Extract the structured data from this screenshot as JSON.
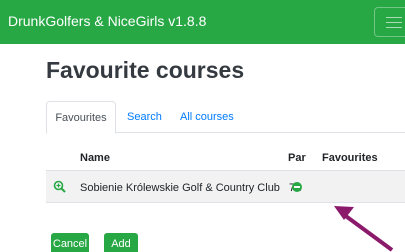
{
  "navbar": {
    "brand": "DrunkGolfers & NiceGirls v1.8.8",
    "menu_icon": "hamburger-icon"
  },
  "page": {
    "title": "Favourite courses"
  },
  "tabs": [
    {
      "label": "Favourites",
      "active": true
    },
    {
      "label": "Search",
      "active": false
    },
    {
      "label": "All courses",
      "active": false
    }
  ],
  "table": {
    "headers": {
      "name": "Name",
      "par": "Par",
      "favourites": "Favourites"
    },
    "rows": [
      {
        "name": "Sobienie Królewskie Golf & Country Club",
        "par": "71",
        "detail_icon": "zoom-in-icon",
        "favourite_icon": "remove-favourite-icon"
      }
    ]
  },
  "actions": {
    "cancel": "Cancel",
    "add": "Add"
  },
  "colors": {
    "brand": "#28a745",
    "link": "#007bff",
    "annotation_arrow": "#8b1a6b"
  }
}
